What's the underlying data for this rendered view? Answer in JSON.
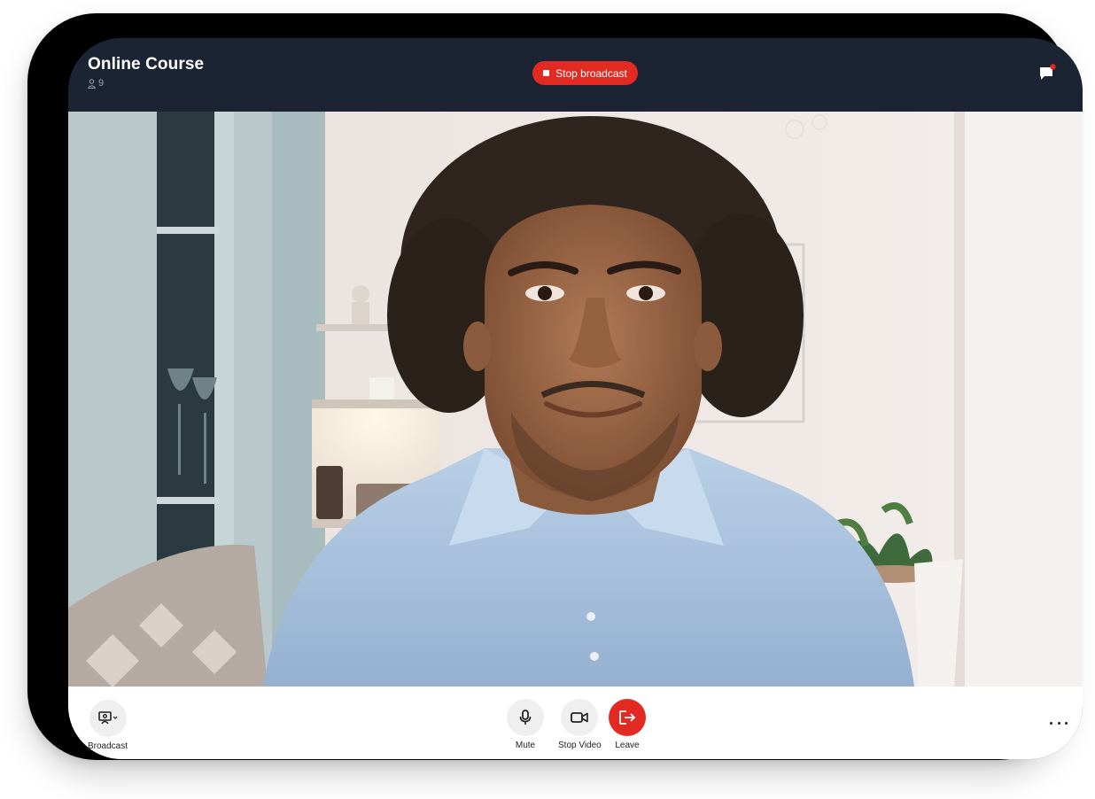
{
  "header": {
    "title": "Online Course",
    "participant_count": "9",
    "stop_broadcast_label": "Stop broadcast",
    "chat_icon": "chat-flag-icon",
    "has_notification": true
  },
  "video": {
    "description_icon": "camera-feed"
  },
  "toolbar": {
    "broadcast_label": "Broadcast",
    "mute_label": "Mute",
    "stop_video_label": "Stop Video",
    "leave_label": "Leave",
    "more_icon": "more-horizontal-icon"
  },
  "colors": {
    "header_bg": "#1c2433",
    "accent_red": "#e32a22",
    "toolbar_bg": "#ffffff",
    "button_bg": "#efefef"
  }
}
